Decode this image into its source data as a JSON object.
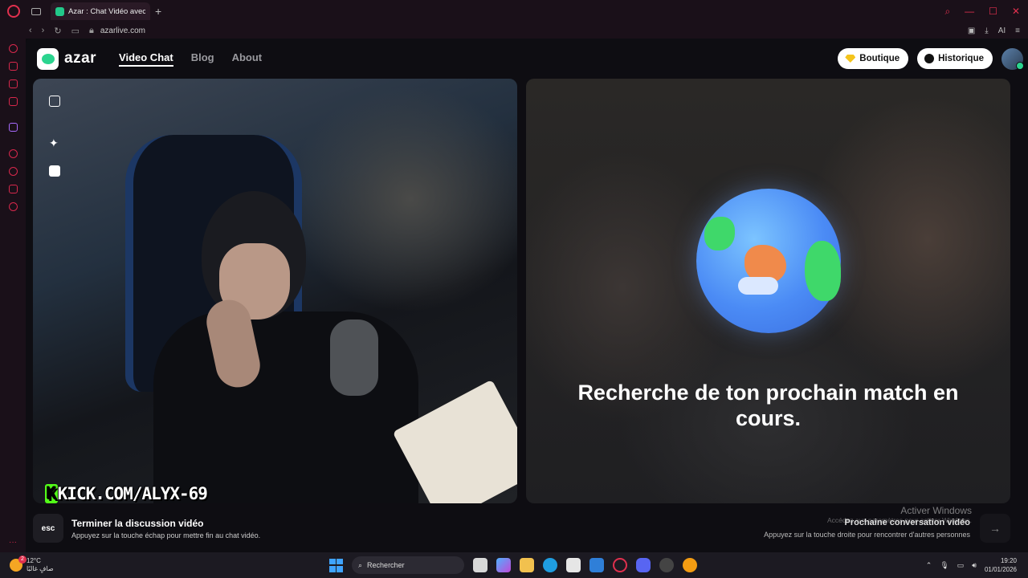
{
  "browser": {
    "tab_title": "Azar : Chat Vidéo avec de",
    "url": "azarlive.com",
    "ai_label": "AI"
  },
  "site": {
    "logo_text": "azar",
    "nav": [
      {
        "label": "Video Chat",
        "active": true
      },
      {
        "label": "Blog",
        "active": false
      },
      {
        "label": "About",
        "active": false
      }
    ],
    "boutique_label": "Boutique",
    "historique_label": "Historique"
  },
  "left_video": {
    "watermark_k": "K",
    "watermark_text": "KICK.COM/ALYX-69"
  },
  "right_video": {
    "status_text": "Recherche de ton prochain match en cours."
  },
  "footer": {
    "esc_label": "esc",
    "end_title": "Terminer la discussion vidéo",
    "end_sub": "Appuyez sur la touche échap pour mettre fin au chat vidéo.",
    "next_title": "Prochaine conversation vidéo",
    "next_sub": "Appuyez sur la touche droite pour rencontrer d'autres personnes",
    "activate_title": "Activer Windows",
    "activate_sub": "Accédez aux paramètres pour activer Windows."
  },
  "taskbar": {
    "temp": "12°C",
    "weather_desc": "صافٍ غالبًا",
    "weather_badge": "2",
    "search_placeholder": "Rechercher",
    "time": "19:20",
    "date": "01/01/2026"
  },
  "colors": {
    "accent": "#e0304e",
    "azar_green": "#2bd48f",
    "kick_green": "#53fc18"
  }
}
